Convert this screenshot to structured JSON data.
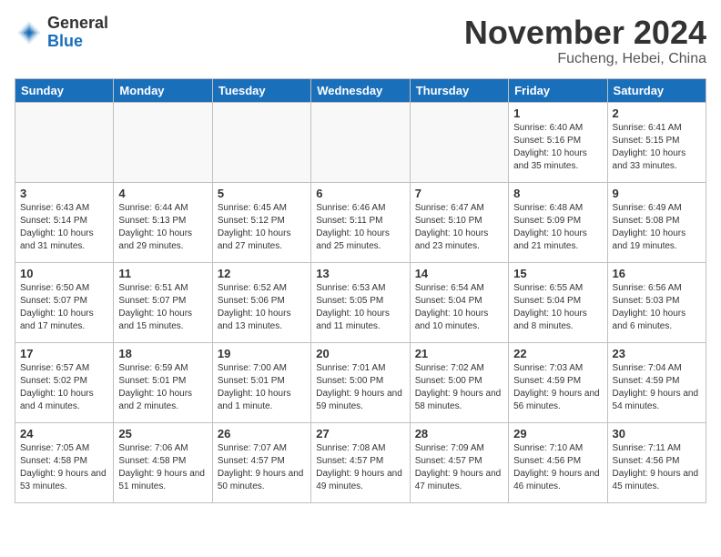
{
  "header": {
    "logo_general": "General",
    "logo_blue": "Blue",
    "month_title": "November 2024",
    "location": "Fucheng, Hebei, China"
  },
  "weekdays": [
    "Sunday",
    "Monday",
    "Tuesday",
    "Wednesday",
    "Thursday",
    "Friday",
    "Saturday"
  ],
  "weeks": [
    [
      {
        "day": "",
        "info": ""
      },
      {
        "day": "",
        "info": ""
      },
      {
        "day": "",
        "info": ""
      },
      {
        "day": "",
        "info": ""
      },
      {
        "day": "",
        "info": ""
      },
      {
        "day": "1",
        "info": "Sunrise: 6:40 AM\nSunset: 5:16 PM\nDaylight: 10 hours\nand 35 minutes."
      },
      {
        "day": "2",
        "info": "Sunrise: 6:41 AM\nSunset: 5:15 PM\nDaylight: 10 hours\nand 33 minutes."
      }
    ],
    [
      {
        "day": "3",
        "info": "Sunrise: 6:43 AM\nSunset: 5:14 PM\nDaylight: 10 hours\nand 31 minutes."
      },
      {
        "day": "4",
        "info": "Sunrise: 6:44 AM\nSunset: 5:13 PM\nDaylight: 10 hours\nand 29 minutes."
      },
      {
        "day": "5",
        "info": "Sunrise: 6:45 AM\nSunset: 5:12 PM\nDaylight: 10 hours\nand 27 minutes."
      },
      {
        "day": "6",
        "info": "Sunrise: 6:46 AM\nSunset: 5:11 PM\nDaylight: 10 hours\nand 25 minutes."
      },
      {
        "day": "7",
        "info": "Sunrise: 6:47 AM\nSunset: 5:10 PM\nDaylight: 10 hours\nand 23 minutes."
      },
      {
        "day": "8",
        "info": "Sunrise: 6:48 AM\nSunset: 5:09 PM\nDaylight: 10 hours\nand 21 minutes."
      },
      {
        "day": "9",
        "info": "Sunrise: 6:49 AM\nSunset: 5:08 PM\nDaylight: 10 hours\nand 19 minutes."
      }
    ],
    [
      {
        "day": "10",
        "info": "Sunrise: 6:50 AM\nSunset: 5:07 PM\nDaylight: 10 hours\nand 17 minutes."
      },
      {
        "day": "11",
        "info": "Sunrise: 6:51 AM\nSunset: 5:07 PM\nDaylight: 10 hours\nand 15 minutes."
      },
      {
        "day": "12",
        "info": "Sunrise: 6:52 AM\nSunset: 5:06 PM\nDaylight: 10 hours\nand 13 minutes."
      },
      {
        "day": "13",
        "info": "Sunrise: 6:53 AM\nSunset: 5:05 PM\nDaylight: 10 hours\nand 11 minutes."
      },
      {
        "day": "14",
        "info": "Sunrise: 6:54 AM\nSunset: 5:04 PM\nDaylight: 10 hours\nand 10 minutes."
      },
      {
        "day": "15",
        "info": "Sunrise: 6:55 AM\nSunset: 5:04 PM\nDaylight: 10 hours\nand 8 minutes."
      },
      {
        "day": "16",
        "info": "Sunrise: 6:56 AM\nSunset: 5:03 PM\nDaylight: 10 hours\nand 6 minutes."
      }
    ],
    [
      {
        "day": "17",
        "info": "Sunrise: 6:57 AM\nSunset: 5:02 PM\nDaylight: 10 hours\nand 4 minutes."
      },
      {
        "day": "18",
        "info": "Sunrise: 6:59 AM\nSunset: 5:01 PM\nDaylight: 10 hours\nand 2 minutes."
      },
      {
        "day": "19",
        "info": "Sunrise: 7:00 AM\nSunset: 5:01 PM\nDaylight: 10 hours\nand 1 minute."
      },
      {
        "day": "20",
        "info": "Sunrise: 7:01 AM\nSunset: 5:00 PM\nDaylight: 9 hours\nand 59 minutes."
      },
      {
        "day": "21",
        "info": "Sunrise: 7:02 AM\nSunset: 5:00 PM\nDaylight: 9 hours\nand 58 minutes."
      },
      {
        "day": "22",
        "info": "Sunrise: 7:03 AM\nSunset: 4:59 PM\nDaylight: 9 hours\nand 56 minutes."
      },
      {
        "day": "23",
        "info": "Sunrise: 7:04 AM\nSunset: 4:59 PM\nDaylight: 9 hours\nand 54 minutes."
      }
    ],
    [
      {
        "day": "24",
        "info": "Sunrise: 7:05 AM\nSunset: 4:58 PM\nDaylight: 9 hours\nand 53 minutes."
      },
      {
        "day": "25",
        "info": "Sunrise: 7:06 AM\nSunset: 4:58 PM\nDaylight: 9 hours\nand 51 minutes."
      },
      {
        "day": "26",
        "info": "Sunrise: 7:07 AM\nSunset: 4:57 PM\nDaylight: 9 hours\nand 50 minutes."
      },
      {
        "day": "27",
        "info": "Sunrise: 7:08 AM\nSunset: 4:57 PM\nDaylight: 9 hours\nand 49 minutes."
      },
      {
        "day": "28",
        "info": "Sunrise: 7:09 AM\nSunset: 4:57 PM\nDaylight: 9 hours\nand 47 minutes."
      },
      {
        "day": "29",
        "info": "Sunrise: 7:10 AM\nSunset: 4:56 PM\nDaylight: 9 hours\nand 46 minutes."
      },
      {
        "day": "30",
        "info": "Sunrise: 7:11 AM\nSunset: 4:56 PM\nDaylight: 9 hours\nand 45 minutes."
      }
    ]
  ]
}
